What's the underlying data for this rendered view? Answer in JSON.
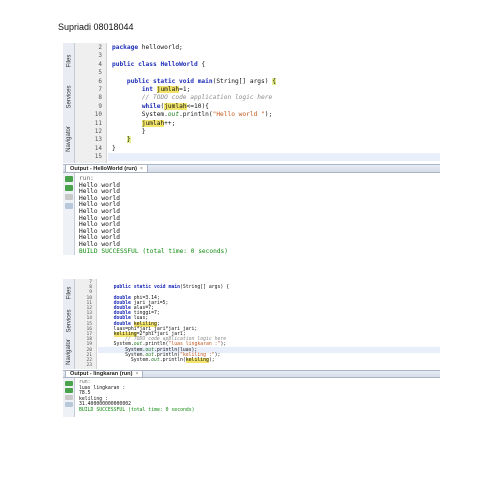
{
  "page_title": "Supriadi 08018044",
  "side_tabs": [
    "Files",
    "Services",
    "Navigator"
  ],
  "screenshot1": {
    "line_numbers": [
      "2",
      "3",
      "4",
      "5",
      "6",
      "7",
      "8",
      "9",
      "10",
      "11",
      "12",
      "13",
      "14",
      "15"
    ],
    "code_lines": [
      [
        {
          "t": "package",
          "c": "kw"
        },
        {
          "t": " helloworld;"
        }
      ],
      [],
      [
        {
          "t": "public class",
          "c": "kw"
        },
        {
          "t": " "
        },
        {
          "t": "HelloWorld",
          "c": "kw"
        },
        {
          "t": " {"
        }
      ],
      [],
      [
        {
          "t": "    "
        },
        {
          "t": "public static void",
          "c": "kw"
        },
        {
          "t": " "
        },
        {
          "t": "main",
          "c": "kw"
        },
        {
          "t": "(String[] args) "
        },
        {
          "t": "{",
          "c": "brace"
        }
      ],
      [
        {
          "t": "        "
        },
        {
          "t": "int",
          "c": "kw"
        },
        {
          "t": " "
        },
        {
          "t": "jumlah",
          "c": "hlv"
        },
        {
          "t": "=1;"
        }
      ],
      [
        {
          "t": "        "
        },
        {
          "t": "// TODO code application logic here",
          "c": "cm"
        }
      ],
      [
        {
          "t": "        "
        },
        {
          "t": "while",
          "c": "kw"
        },
        {
          "t": "("
        },
        {
          "t": "jumlah",
          "c": "hlv"
        },
        {
          "t": "<=10){"
        }
      ],
      [
        {
          "t": "        System."
        },
        {
          "t": "out",
          "c": "ou"
        },
        {
          "t": ".println("
        },
        {
          "t": "\"Hello world \"",
          "c": "st"
        },
        {
          "t": ");"
        }
      ],
      [
        {
          "t": "        "
        },
        {
          "t": "jumlah",
          "c": "hlv"
        },
        {
          "t": "++;"
        }
      ],
      [
        {
          "t": "        }"
        }
      ],
      [
        {
          "t": "    "
        },
        {
          "t": "}",
          "c": "brace"
        }
      ],
      [
        {
          "t": "}"
        }
      ],
      []
    ],
    "output_tab": "Output - HelloWorld (run)",
    "output_close": "×",
    "output_lines": [
      {
        "t": "run:",
        "c": "gray"
      },
      {
        "t": "Hello world"
      },
      {
        "t": "Hello world"
      },
      {
        "t": "Hello world"
      },
      {
        "t": "Hello world"
      },
      {
        "t": "Hello world"
      },
      {
        "t": "Hello world"
      },
      {
        "t": "Hello world"
      },
      {
        "t": "Hello world"
      },
      {
        "t": "Hello world"
      },
      {
        "t": "Hello world"
      },
      {
        "t": "BUILD SUCCESSFUL (total time: 0 seconds)",
        "c": "green"
      }
    ]
  },
  "screenshot2": {
    "line_numbers": [
      "7",
      "8",
      "9",
      "10",
      "11",
      "12",
      "13",
      "14",
      "15",
      "16",
      "17",
      "18",
      "19",
      "20",
      "21",
      "22",
      "23"
    ],
    "code_lines": [
      [],
      [
        {
          "t": "    "
        },
        {
          "t": "public static void",
          "c": "kw"
        },
        {
          "t": " "
        },
        {
          "t": "main",
          "c": "kw"
        },
        {
          "t": "(String[] args) {"
        }
      ],
      [],
      [
        {
          "t": "    "
        },
        {
          "t": "double",
          "c": "kw"
        },
        {
          "t": " phi=3.14;"
        }
      ],
      [
        {
          "t": "    "
        },
        {
          "t": "double",
          "c": "kw"
        },
        {
          "t": " jari_jari=5;"
        }
      ],
      [
        {
          "t": "    "
        },
        {
          "t": "double",
          "c": "kw"
        },
        {
          "t": " alas=7;"
        }
      ],
      [
        {
          "t": "    "
        },
        {
          "t": "double",
          "c": "kw"
        },
        {
          "t": " tinggi=7;"
        }
      ],
      [
        {
          "t": "    "
        },
        {
          "t": "double",
          "c": "kw"
        },
        {
          "t": " luas;"
        }
      ],
      [
        {
          "t": "    "
        },
        {
          "t": "double",
          "c": "kw"
        },
        {
          "t": " "
        },
        {
          "t": "keliling",
          "c": "hlv"
        },
        {
          "t": ";"
        }
      ],
      [
        {
          "t": "    luas=phi*jari_jari*jari_jari;"
        }
      ],
      [
        {
          "t": "    "
        },
        {
          "t": "keliling",
          "c": "hlv"
        },
        {
          "t": "=2*phi*jari_jari;"
        }
      ],
      [
        {
          "t": "        "
        },
        {
          "t": "// TODO code application logic here",
          "c": "cm"
        }
      ],
      [
        {
          "t": "    System."
        },
        {
          "t": "out",
          "c": "ou"
        },
        {
          "t": ".println("
        },
        {
          "t": "\"luas lingkaran :\"",
          "c": "st"
        },
        {
          "t": ");"
        }
      ],
      [
        {
          "t": "        System."
        },
        {
          "t": "out",
          "c": "ou"
        },
        {
          "t": ".println(luas);"
        }
      ],
      [
        {
          "t": "        System."
        },
        {
          "t": "out",
          "c": "ou"
        },
        {
          "t": ".println("
        },
        {
          "t": "\"keliling :\"",
          "c": "st"
        },
        {
          "t": ");"
        }
      ],
      [
        {
          "t": "          System."
        },
        {
          "t": "out",
          "c": "ou"
        },
        {
          "t": ".println("
        },
        {
          "t": "keliling",
          "c": "hlv"
        },
        {
          "t": ");"
        }
      ],
      []
    ],
    "output_tab": "Output - lingkaran (run)",
    "output_close": "×",
    "output_lines": [
      {
        "t": "run:",
        "c": "gray"
      },
      {
        "t": "luas lingkaran :"
      },
      {
        "t": "78.5"
      },
      {
        "t": "keliling :"
      },
      {
        "t": "31.400000000000002"
      },
      {
        "t": "BUILD SUCCESSFUL (total time: 0 seconds)",
        "c": "green"
      }
    ]
  }
}
